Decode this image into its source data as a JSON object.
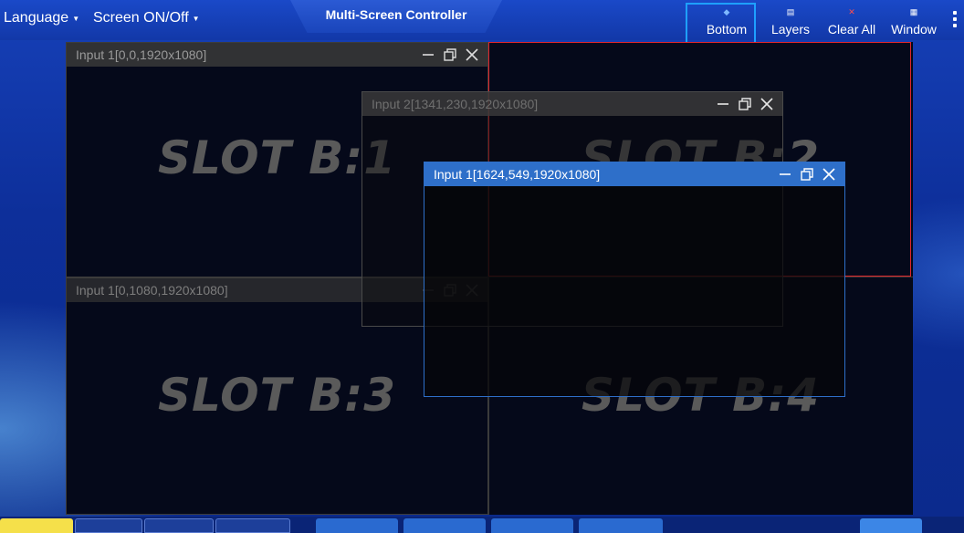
{
  "menu": {
    "language": "Language",
    "screen": "Screen ON/Off"
  },
  "title": "Multi-Screen Controller",
  "toolbar": {
    "bottom": "Bottom",
    "layers": "Layers",
    "clear_all": "Clear All",
    "window": "Window",
    "clear_all_icon_color": "#ff4d4d"
  },
  "slots": {
    "b1": "SLOT B:1",
    "b2": "SLOT B:2",
    "b3": "SLOT B:3",
    "b4": "SLOT B:4"
  },
  "windows": {
    "w1": "Input 1[0,0,1920x1080]",
    "w2": "Input 2[1341,230,1920x1080]",
    "w3": "Input 1[1624,549,1920x1080]",
    "w4": "Input 1[0,1080,1920x1080]"
  },
  "colors": {
    "selected_slot_border": "#e0262b",
    "highlight": "#1ea0ff",
    "active_window_bar": "#2e6fc9"
  }
}
